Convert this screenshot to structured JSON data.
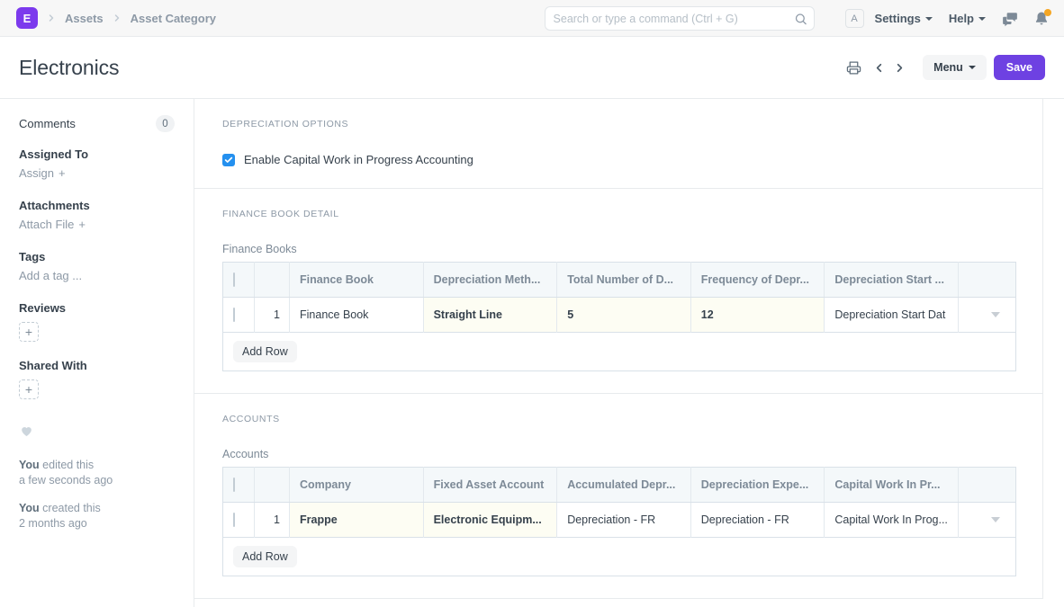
{
  "navbar": {
    "logo_letter": "E",
    "breadcrumbs": [
      "Assets",
      "Asset Category"
    ],
    "search": {
      "placeholder": "Search or type a command (Ctrl + G)",
      "value": ""
    },
    "avatar_letter": "A",
    "settings_label": "Settings",
    "help_label": "Help",
    "icons": {
      "chat": "chat-icon",
      "notifications": "bell-icon"
    }
  },
  "pagehead": {
    "title": "Electronics",
    "print_icon": "printer-icon",
    "prev_icon": "chevron-left-icon",
    "next_icon": "chevron-right-icon",
    "menu_label": "Menu",
    "save_label": "Save"
  },
  "sidebar": {
    "comments_label": "Comments",
    "comments_count": "0",
    "assigned_to_label": "Assigned To",
    "assign_label": "Assign",
    "attachments_label": "Attachments",
    "attach_file_label": "Attach File",
    "tags_label": "Tags",
    "add_tag_label": "Add a tag ...",
    "reviews_label": "Reviews",
    "shared_with_label": "Shared With",
    "plus": "+",
    "like_icon": "heart-icon",
    "history": [
      {
        "who": "You",
        "action": " edited this",
        "time": "a few seconds ago"
      },
      {
        "who": "You",
        "action": " created this",
        "time": "2 months ago"
      }
    ]
  },
  "sections": {
    "depreciation_options": {
      "title": "Depreciation Options",
      "checkbox_label": "Enable Capital Work in Progress Accounting",
      "checkbox_checked": true
    },
    "finance_book_detail": {
      "title": "Finance Book Detail",
      "grid_label": "Finance Books",
      "columns": [
        "Finance Book",
        "Depreciation Meth...",
        "Total Number of D...",
        "Frequency of Depr...",
        "Depreciation Start ..."
      ],
      "rows": [
        {
          "index": "1",
          "finance_book": "Finance Book",
          "depreciation_method": "Straight Line",
          "total_number_of_depreciations": "5",
          "frequency_of_depreciation": "12",
          "depreciation_start_date": "Depreciation Start Dat"
        }
      ],
      "add_row_label": "Add Row"
    },
    "accounts": {
      "title": "Accounts",
      "grid_label": "Accounts",
      "columns": [
        "Company",
        "Fixed Asset Account",
        "Accumulated Depr...",
        "Depreciation Expe...",
        "Capital Work In Pr..."
      ],
      "rows": [
        {
          "index": "1",
          "company": "Frappe",
          "fixed_asset_account": "Electronic Equipm...",
          "accumulated_depreciation_account": "Depreciation - FR",
          "depreciation_expense_account": "Depreciation - FR",
          "capital_work_in_progress_account": "Capital Work In Prog..."
        }
      ],
      "add_row_label": "Add Row"
    }
  },
  "colors": {
    "brand_purple": "#6e41e2",
    "logo_purple": "#7c3aed",
    "checkbox_blue": "#2490ef",
    "notification_orange": "#f5a623",
    "highlight_cell": "#fdfdf3",
    "header_bg": "#f4f8fa"
  }
}
